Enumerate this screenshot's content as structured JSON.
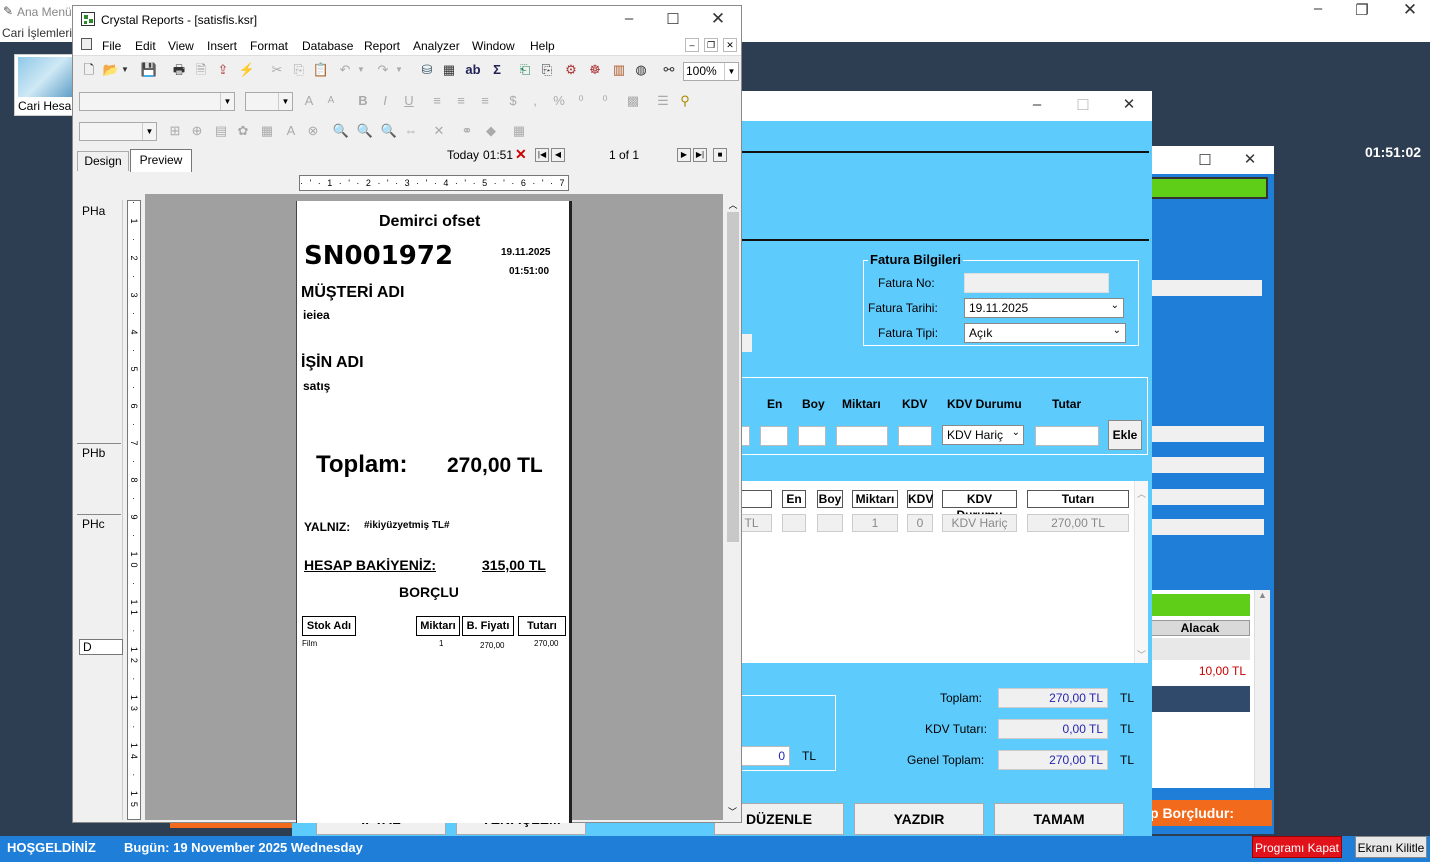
{
  "main_window": {
    "title": "Ana Menü",
    "menu": "Cari İşlemleri",
    "shortcut_label": "Cari Hesap",
    "clock": "01:51:02"
  },
  "status_bar": {
    "welcome": "HOŞGELDİNİZ",
    "date": "Bugün: 19 November 2025 Wednesday",
    "close_program": "Programı Kapat",
    "lock_screen": "Ekranı Kilitle"
  },
  "back_window": {
    "alacak_header": "Alacak",
    "alacak_value": "10,00 TL",
    "borclu_text": "p Borçludur:"
  },
  "invoice_window": {
    "fatura_group_title": "Fatura Bilgileri",
    "fatura_no_label": "Fatura No:",
    "fatura_no_value": "",
    "fatura_tarihi_label": "Fatura Tarihi:",
    "fatura_tarihi_value": "19.11.2025",
    "fatura_tipi_label": "Fatura Tipi:",
    "fatura_tipi_value": "Açık",
    "entry_headers": {
      "en": "En",
      "boy": "Boy",
      "miktari": "Miktarı",
      "kdv": "KDV",
      "kdv_durumu": "KDV Durumu",
      "tutar": "Tutarı"
    },
    "tutar_header": "Tutar",
    "kdv_durumu_select": "KDV Hariç",
    "ekle_button": "Ekle",
    "grid_headers": {
      "en": "En",
      "boy": "Boy",
      "miktari": "Miktarı",
      "kdv": "KDV",
      "kdv_durumu": "KDV Durumu",
      "tutari": "Tutarı"
    },
    "grid_row": {
      "col0": "TL",
      "en": "",
      "boy": "",
      "miktari": "1",
      "kdv": "0",
      "kdv_durumu": "KDV Hariç",
      "tutari": "270,00 TL"
    },
    "discount_value": "0",
    "discount_unit": "TL",
    "toplam_label": "Toplam:",
    "toplam_value": "270,00 TL",
    "kdv_tutari_label": "KDV Tutarı:",
    "kdv_tutari_value": "0,00 TL",
    "genel_toplam_label": "Genel Toplam:",
    "genel_toplam_value": "270,00 TL",
    "currency": "TL",
    "buttons": {
      "iptal": "İPTAL",
      "yeni": "YENİ İŞLEM",
      "duzenle": "DÜZENLE",
      "yazdir": "YAZDIR",
      "tamam": "TAMAM"
    }
  },
  "crystal": {
    "title": "Crystal Reports - [satisfis.ksr]",
    "menu": [
      "File",
      "Edit",
      "View",
      "Insert",
      "Format",
      "Database",
      "Report",
      "Analyzer",
      "Window",
      "Help"
    ],
    "zoom": "100%",
    "tabs": {
      "design": "Design",
      "preview": "Preview"
    },
    "today": "Today",
    "time": "01:51",
    "page_info": "1 of 1",
    "sections": {
      "pha": "PHa",
      "phb": "PHb",
      "phc": "PHc",
      "d": "D"
    }
  },
  "report": {
    "company": "Demirci ofset",
    "receipt_no": "SN001972",
    "date": "19.11.2025",
    "time": "01:51:00",
    "customer_label": "MÜŞTERİ ADI",
    "customer_name": "ieiea",
    "job_label": "İŞİN ADI",
    "job_name": "satış",
    "total_label": "Toplam:",
    "total_value": "270,00 TL",
    "yalniz_label": "YALNIZ:",
    "yalniz_value": "#ikiyüzyetmiş TL#",
    "balance_label": "HESAP BAKİYENİZ:",
    "balance_value": "315,00 TL",
    "balance_status": "BORÇLU",
    "columns": {
      "stok": "Stok Adı",
      "miktar": "Miktarı",
      "fiyat": "B. Fiyatı",
      "tutar": "Tutarı"
    },
    "row": {
      "stok": "Film",
      "miktar": "1",
      "fiyat": "270,00",
      "tutar": "270,00"
    }
  }
}
